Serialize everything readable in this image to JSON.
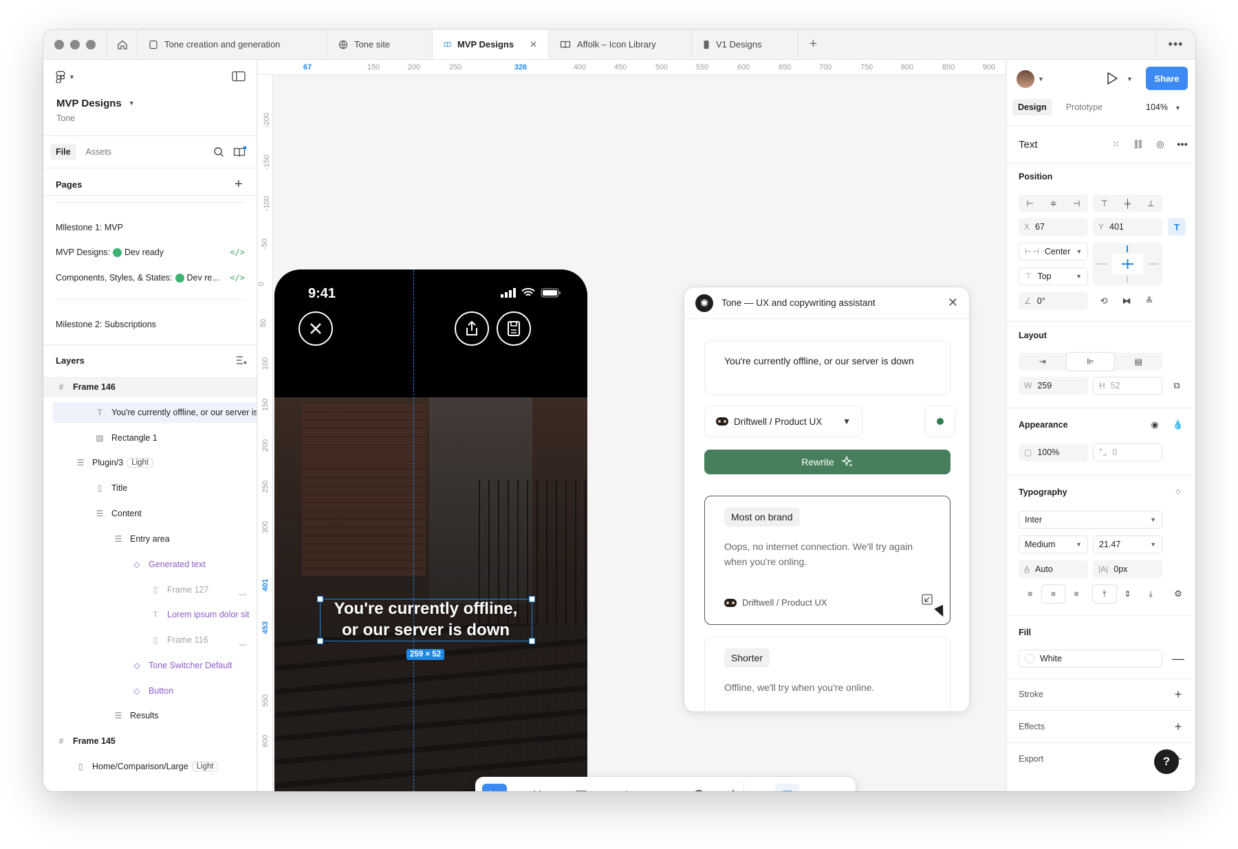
{
  "tabs": [
    {
      "label": "Tone creation and generation",
      "icon": "file-icon"
    },
    {
      "label": "Tone site",
      "icon": "globe-icon"
    },
    {
      "label": "MVP Designs",
      "icon": "book-icon",
      "active": true
    },
    {
      "label": "Affolk – Icon Library",
      "icon": "book-icon"
    },
    {
      "label": "V1 Designs",
      "icon": "phone-icon"
    }
  ],
  "left": {
    "file_name": "MVP Designs",
    "project": "Tone",
    "file_tab": "File",
    "assets_tab": "Assets",
    "pages_title": "Pages",
    "pages": [
      "Mllestone 1: MVP",
      "MVP Designs:",
      "Dev ready",
      "Components, Styles, & States:",
      "Dev re...",
      "Milestone 2: Subscriptions"
    ],
    "layers_title": "Layers",
    "layers": [
      {
        "label": "Frame 146"
      },
      {
        "label": "You're currently offline, or our server is down"
      },
      {
        "label": "Rectangle 1"
      },
      {
        "label": "Plugin/3",
        "chip": "Light"
      },
      {
        "label": "Title"
      },
      {
        "label": "Content"
      },
      {
        "label": "Entry area"
      },
      {
        "label": "Generated text"
      },
      {
        "label": "Frame 127"
      },
      {
        "label": "Lorem ipsum dolor sit"
      },
      {
        "label": "Frame 116"
      },
      {
        "label": "Tone Switcher Default"
      },
      {
        "label": "Button"
      },
      {
        "label": "Results"
      },
      {
        "label": "Frame 145"
      },
      {
        "label": "Home/Comparison/Large",
        "chip": "Light"
      }
    ]
  },
  "ruler_top": [
    "67",
    "150",
    "200",
    "250",
    "326",
    "400",
    "450",
    "500",
    "550",
    "600",
    "650",
    "700",
    "750",
    "800",
    "850",
    "900"
  ],
  "ruler_left": [
    "-200",
    "-150",
    "-100",
    "-50",
    "0",
    "50",
    "100",
    "150",
    "200",
    "250",
    "300",
    "401",
    "453",
    "550",
    "600"
  ],
  "phone": {
    "time": "9:41",
    "overlay_text_line1": "You're currently offline,",
    "overlay_text_line2": "or our server is down",
    "dimension_badge": "259 × 52"
  },
  "plugin": {
    "title": "Tone — UX and copywriting assistant",
    "input_text": "You're currently offline, or our server is down",
    "tone_select": "Driftwell / Product UX",
    "rewrite_label": "Rewrite",
    "results": [
      {
        "tag": "Most on brand",
        "text": "Oops, no internet connection. We'll try again when you're onling.",
        "meta": "Driftwell / Product UX"
      },
      {
        "tag": "Shorter",
        "text": "Offline, we'll try when you're online."
      }
    ]
  },
  "right": {
    "share_label": "Share",
    "design_tab": "Design",
    "prototype_tab": "Prototype",
    "zoom": "104%",
    "selection_type": "Text",
    "position_title": "Position",
    "x_label": "X",
    "x_value": "67",
    "y_label": "Y",
    "y_value": "401",
    "h_constraint": "Center",
    "v_constraint": "Top",
    "rotation": "0°",
    "layout_title": "Layout",
    "w_label": "W",
    "w_value": "259",
    "h_label": "H",
    "h_value": "52",
    "appearance_title": "Appearance",
    "opacity": "100%",
    "radius": "0",
    "typography_title": "Typography",
    "font_family": "Inter",
    "font_weight": "Medium",
    "font_size": "21.47",
    "line_height": "Auto",
    "letter_spacing": "0px",
    "fill_title": "Fill",
    "fill_value": "White",
    "stroke_title": "Stroke",
    "effects_title": "Effects",
    "export_title": "Export"
  },
  "help_label": "?"
}
